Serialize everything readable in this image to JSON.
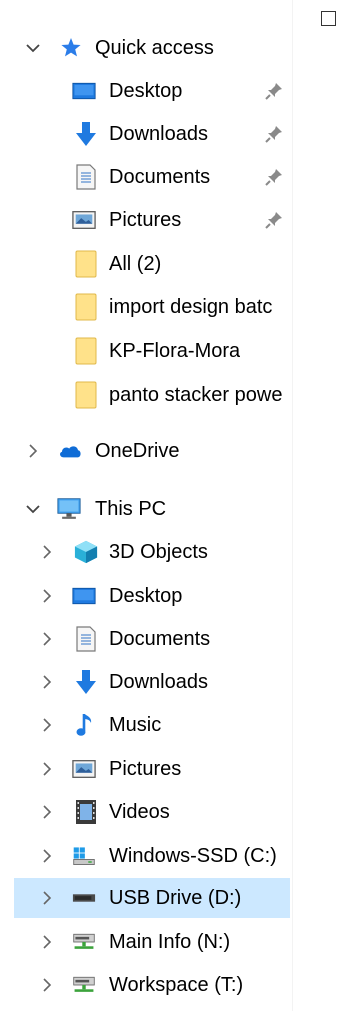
{
  "quick_access": {
    "label": "Quick access",
    "items": [
      {
        "label": "Desktop",
        "icon": "desktop-icon",
        "pinned": true
      },
      {
        "label": "Downloads",
        "icon": "downloads-icon",
        "pinned": true
      },
      {
        "label": "Documents",
        "icon": "documents-icon",
        "pinned": true
      },
      {
        "label": "Pictures",
        "icon": "pictures-icon",
        "pinned": true
      },
      {
        "label": "All (2)",
        "icon": "folder-icon",
        "pinned": false
      },
      {
        "label": "import design batc",
        "icon": "folder-icon",
        "pinned": false
      },
      {
        "label": "KP-Flora-Mora",
        "icon": "folder-icon",
        "pinned": false
      },
      {
        "label": "panto stacker powe",
        "icon": "folder-icon",
        "pinned": false
      }
    ]
  },
  "onedrive": {
    "label": "OneDrive"
  },
  "this_pc": {
    "label": "This PC",
    "items": [
      {
        "label": "3D Objects",
        "icon": "3d-objects-icon"
      },
      {
        "label": "Desktop",
        "icon": "desktop-icon"
      },
      {
        "label": "Documents",
        "icon": "documents-icon"
      },
      {
        "label": "Downloads",
        "icon": "downloads-icon"
      },
      {
        "label": "Music",
        "icon": "music-icon"
      },
      {
        "label": "Pictures",
        "icon": "pictures-icon"
      },
      {
        "label": "Videos",
        "icon": "videos-icon"
      },
      {
        "label": "Windows-SSD (C:)",
        "icon": "windows-drive-icon"
      },
      {
        "label": "USB Drive (D:)",
        "icon": "usb-drive-icon",
        "selected": true
      },
      {
        "label": "Main Info (N:)",
        "icon": "network-drive-icon"
      },
      {
        "label": "Workspace (T:)",
        "icon": "network-drive-icon"
      }
    ]
  },
  "colors": {
    "selected_bg": "#cce8ff",
    "folder_yellow": "#ffe28a",
    "blue": "#1f7ae0",
    "pin_gray": "#8a8a8a",
    "chevron_gray": "#5a5a5a"
  }
}
